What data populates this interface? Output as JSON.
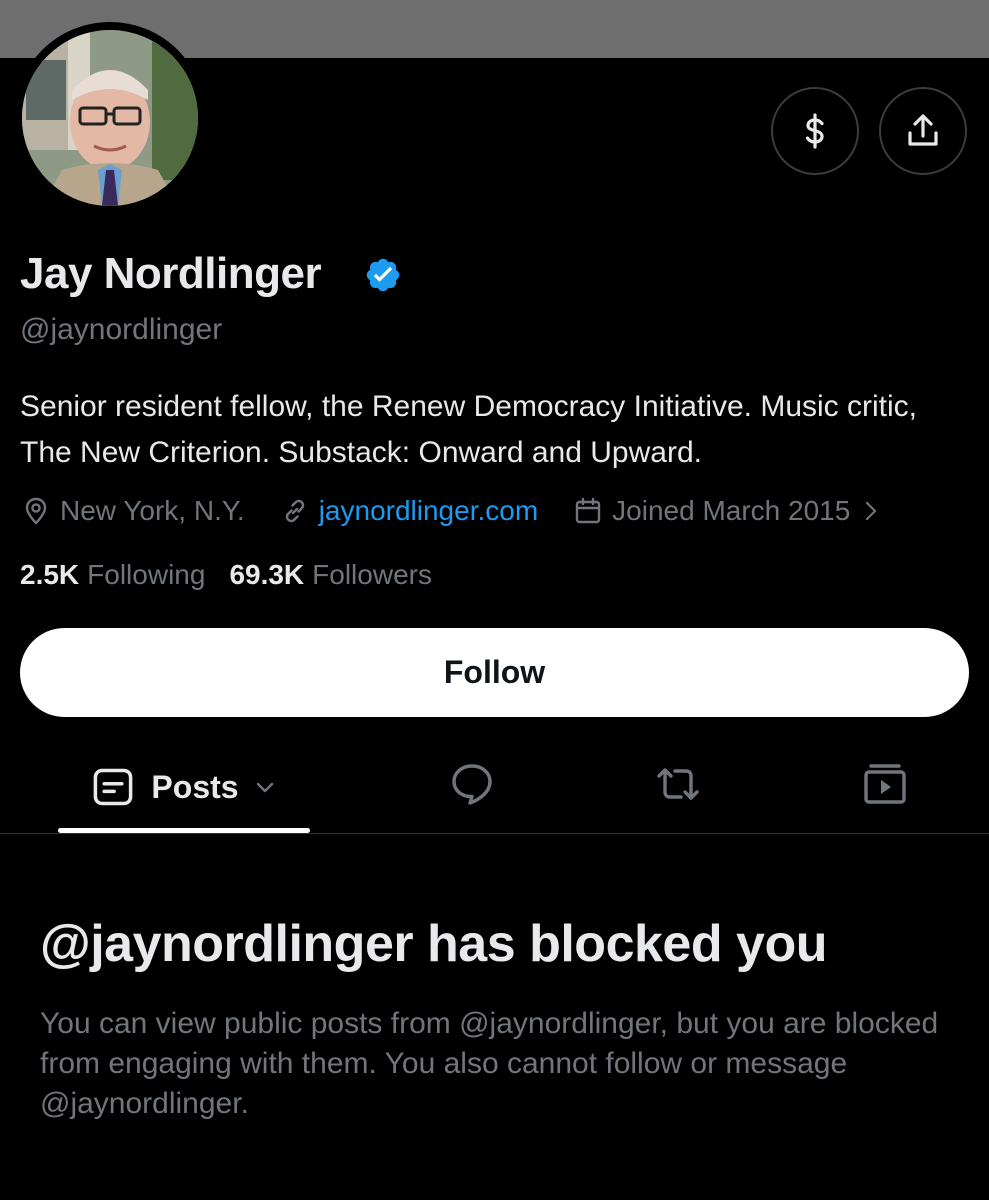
{
  "profile": {
    "display_name": "Jay Nordlinger",
    "handle": "@jaynordlinger",
    "verified": true,
    "bio": "Senior resident fellow, the Renew Democracy Initiative. Music critic, The New Criterion. Substack: Onward and Upward.",
    "location": "New York, N.Y.",
    "website": "jaynordlinger.com",
    "joined": "Joined March 2015",
    "following_count": "2.5K",
    "following_label": "Following",
    "followers_count": "69.3K",
    "followers_label": "Followers"
  },
  "actions": {
    "follow_label": "Follow",
    "tip_icon": "dollar-sign-icon",
    "share_icon": "share-upload-icon"
  },
  "tabs": {
    "posts_label": "Posts",
    "icons": [
      "posts-icon",
      "replies-icon",
      "reposts-icon",
      "media-icon"
    ]
  },
  "blocked": {
    "title": "@jaynordlinger has blocked you",
    "description": "You can view public posts from @jaynordlinger, but you are blocked from engaging with them. You also cannot follow or message @jaynordlinger."
  },
  "colors": {
    "background": "#000000",
    "banner": "#6e6e6e",
    "text_primary": "#e7e9ea",
    "text_secondary": "#71767b",
    "link": "#1d9bf0",
    "verified_badge": "#1d9bf0",
    "follow_button_bg": "#ffffff"
  }
}
